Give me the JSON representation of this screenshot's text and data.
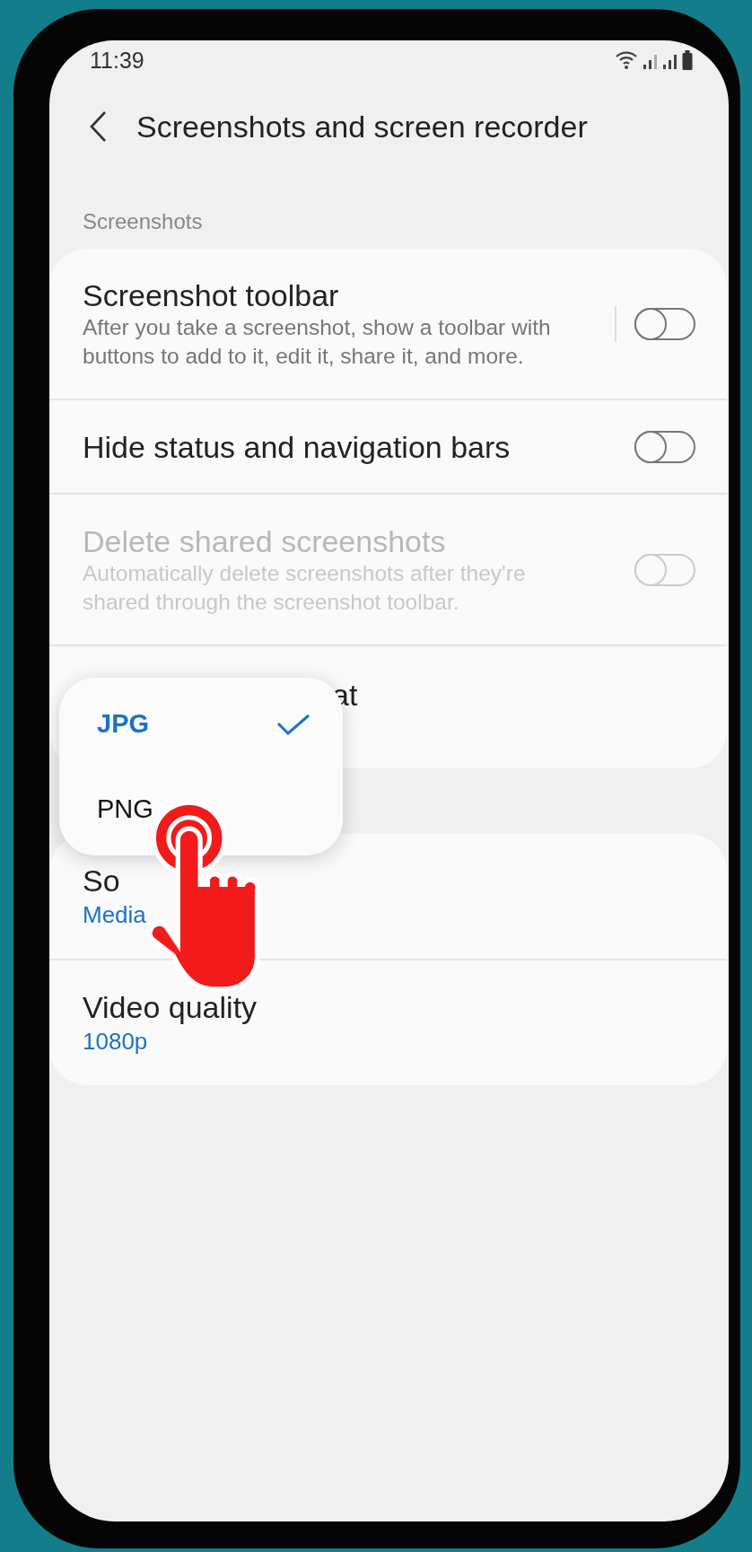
{
  "status_bar": {
    "time": "11:39"
  },
  "header": {
    "title": "Screenshots and screen recorder"
  },
  "sections": [
    {
      "title": "Screenshots",
      "items": [
        {
          "kind": "switch",
          "title": "Screenshot toolbar",
          "description": "After you take a screenshot, show a toolbar with buttons to add to it, edit it, share it, and more.",
          "on": false,
          "disabled": false,
          "split": true
        },
        {
          "kind": "switch",
          "title": "Hide status and navigation bars",
          "on": false,
          "disabled": false,
          "split": false
        },
        {
          "kind": "switch",
          "title": "Delete shared screenshots",
          "description": "Automatically delete screenshots after they're shared through the screenshot toolbar.",
          "on": false,
          "disabled": true,
          "split": false
        },
        {
          "kind": "covered",
          "title": "at"
        }
      ]
    },
    {
      "items": [
        {
          "kind": "value",
          "title": "So",
          "value": "Media"
        },
        {
          "kind": "value",
          "title": "Video quality",
          "value": "1080p"
        }
      ]
    }
  ],
  "popup": {
    "options": [
      {
        "label": "JPG",
        "selected": true
      },
      {
        "label": "PNG",
        "selected": false
      }
    ]
  }
}
